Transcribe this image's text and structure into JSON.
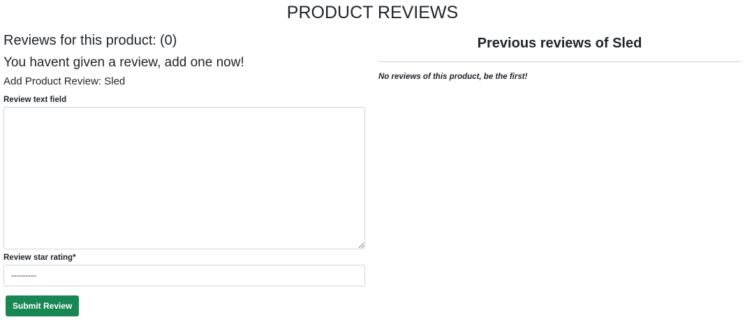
{
  "page": {
    "title": "PRODUCT REVIEWS"
  },
  "review_form": {
    "count_prefix": "Reviews for this product:",
    "count_value": "(0)",
    "no_review_message": "You havent given a review, add one now!",
    "add_review_heading": "Add Product Review: Sled",
    "text_field_label": "Review text field",
    "text_field_value": "",
    "rating_label": "Review star rating*",
    "rating_selected": "---------",
    "submit_label": "Submit Review",
    "submit_color": "#198754"
  },
  "previous_reviews": {
    "title": "Previous reviews of Sled",
    "empty_message": "No reviews of this product, be the first!"
  }
}
